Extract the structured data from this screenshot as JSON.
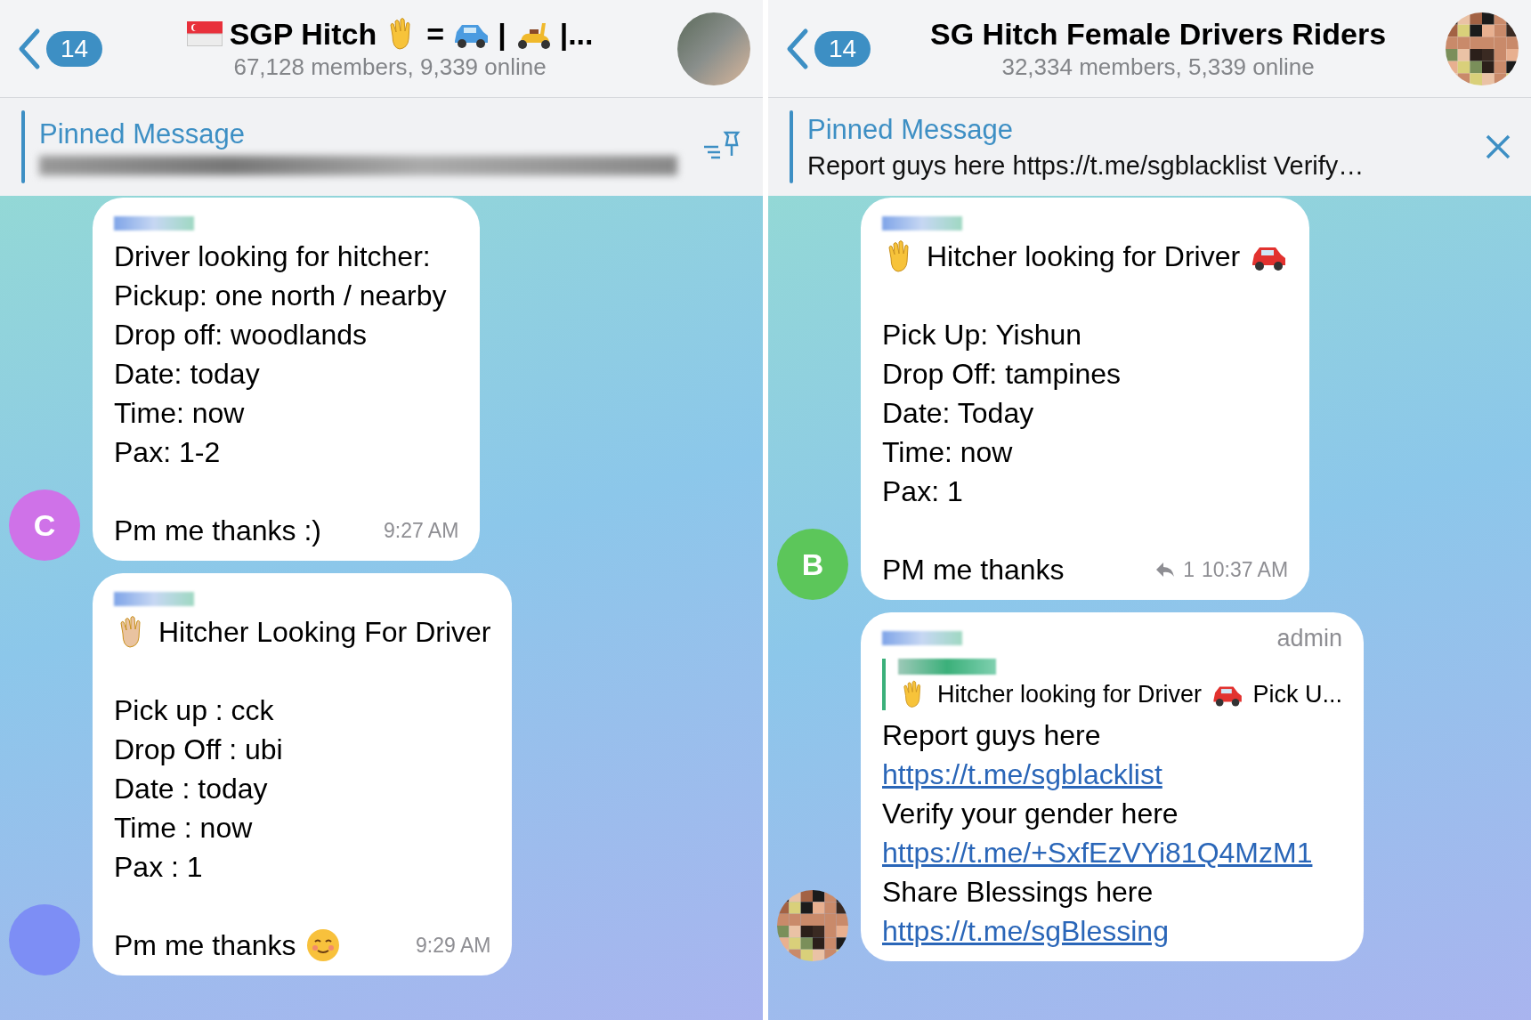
{
  "panels": [
    {
      "header": {
        "back_count": "14",
        "title_parts": [
          {
            "kind": "flag"
          },
          {
            "kind": "text",
            "text": "SGP Hitch"
          },
          {
            "kind": "wave"
          },
          {
            "kind": "text",
            "text": "="
          },
          {
            "kind": "bluecar"
          },
          {
            "kind": "text",
            "text": "|"
          },
          {
            "kind": "scooter"
          },
          {
            "kind": "text",
            "text": "|..."
          }
        ],
        "subtitle": "67,128 members, 9,339 online",
        "avatar": {
          "kind": "photo"
        }
      },
      "pinned": {
        "label": "Pinned Message",
        "button": {
          "kind": "pin"
        }
      },
      "messages": [
        {
          "avatar": {
            "kind": "letter",
            "letter": "C",
            "color": "#cf72e8"
          },
          "paragraphs": [
            [
              {
                "text": "Driver looking for hitcher:"
              },
              {
                "text": "Pickup: one north / nearby"
              },
              {
                "text": "Drop off: woodlands"
              },
              {
                "text": "Date: today"
              },
              {
                "text": "Time: now"
              },
              {
                "text": "Pax: 1-2"
              }
            ],
            [
              {
                "text": "Pm me thanks :)"
              }
            ]
          ],
          "time": "9:27 AM"
        },
        {
          "avatar": {
            "kind": "plain",
            "color": "#7d8ef5"
          },
          "paragraphs": [
            [
              {
                "text": "Hitcher Looking For Driver",
                "lead": {
                  "kind": "wavetone"
                }
              }
            ],
            [
              {
                "text": "Pick up : cck"
              },
              {
                "text": "Drop Off :  ubi"
              },
              {
                "text": "Date : today"
              },
              {
                "text": "Time : now"
              },
              {
                "text": "Pax : 1"
              }
            ],
            [
              {
                "text": "Pm me thanks",
                "trail": {
                  "kind": "blush"
                }
              }
            ]
          ],
          "time": "9:29 AM"
        }
      ]
    },
    {
      "header": {
        "back_count": "14",
        "title_parts": [
          {
            "kind": "text",
            "text": "SG Hitch Female Drivers Riders"
          }
        ],
        "subtitle": "32,334 members, 5,339 online",
        "avatar": {
          "kind": "pixelated"
        }
      },
      "pinned": {
        "label": "Pinned Message",
        "text": "Report guys here https://t.me/sgblacklist Verify…",
        "button": {
          "kind": "close"
        }
      },
      "messages": [
        {
          "avatar": {
            "kind": "letter",
            "letter": "B",
            "color": "#5cc65a"
          },
          "paragraphs": [
            [
              {
                "text": "Hitcher looking for Driver",
                "lead": {
                  "kind": "wave"
                },
                "trail": {
                  "kind": "car"
                }
              }
            ],
            [
              {
                "text": "Pick Up: Yishun"
              },
              {
                "text": "Drop Off: tampines"
              },
              {
                "text": "Date: Today"
              },
              {
                "text": "Time: now"
              },
              {
                "text": "Pax: 1"
              }
            ],
            [
              {
                "text": "PM me thanks"
              }
            ]
          ],
          "replies": "1",
          "time": "10:37 AM"
        },
        {
          "avatar": {
            "kind": "pixelated"
          },
          "role": "admin",
          "reply": {
            "quote_parts": [
              {
                "kind": "wave"
              },
              {
                "kind": "text",
                "text": "Hitcher looking for Driver"
              },
              {
                "kind": "car"
              },
              {
                "kind": "text",
                "text": "Pick U..."
              }
            ]
          },
          "paragraphs": [
            [
              {
                "text": "Report guys here"
              },
              {
                "text": "https://t.me/sgblacklist",
                "kind": "link"
              },
              {
                "text": "Verify your gender here"
              },
              {
                "text": "https://t.me/+SxfEzVYi81Q4MzM1",
                "kind": "link"
              },
              {
                "text": "Share Blessings here"
              },
              {
                "text": "https://t.me/sgBlessing",
                "kind": "link"
              }
            ]
          ]
        }
      ]
    }
  ]
}
